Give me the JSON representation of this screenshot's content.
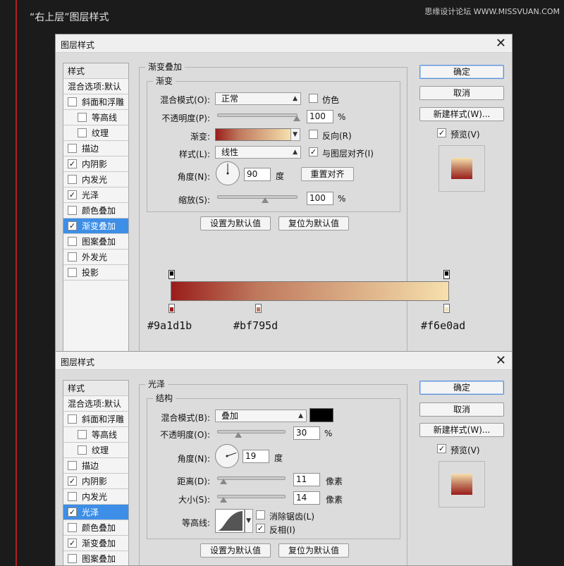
{
  "page_heading": "“右上层”图层样式",
  "watermark": "思缘设计论坛 WWW.MISSVUAN.COM",
  "dialog1": {
    "title": "图层样式",
    "styles_header": "样式",
    "blend_options": "混合选项:默认",
    "style_items": [
      {
        "label": "斜面和浮雕",
        "checked": false,
        "indent": false,
        "selected": false
      },
      {
        "label": "等高线",
        "checked": false,
        "indent": true,
        "selected": false
      },
      {
        "label": "纹理",
        "checked": false,
        "indent": true,
        "selected": false
      },
      {
        "label": "描边",
        "checked": false,
        "indent": false,
        "selected": false
      },
      {
        "label": "内阴影",
        "checked": true,
        "indent": false,
        "selected": false
      },
      {
        "label": "内发光",
        "checked": false,
        "indent": false,
        "selected": false
      },
      {
        "label": "光泽",
        "checked": true,
        "indent": false,
        "selected": false
      },
      {
        "label": "颜色叠加",
        "checked": false,
        "indent": false,
        "selected": false
      },
      {
        "label": "渐变叠加",
        "checked": true,
        "indent": false,
        "selected": true
      },
      {
        "label": "图案叠加",
        "checked": false,
        "indent": false,
        "selected": false
      },
      {
        "label": "外发光",
        "checked": false,
        "indent": false,
        "selected": false
      },
      {
        "label": "投影",
        "checked": false,
        "indent": false,
        "selected": false
      }
    ],
    "section_title": "渐变叠加",
    "subsection_title": "渐变",
    "blend_mode_label": "混合模式(O):",
    "blend_mode_value": "正常",
    "dither_label": "仿色",
    "dither_checked": false,
    "opacity_label": "不透明度(P):",
    "opacity_value": "100",
    "percent": "%",
    "opacity_level": 1.0,
    "gradient_label": "渐变:",
    "reverse_label": "反向(R)",
    "reverse_checked": false,
    "style_label": "样式(L):",
    "style_value": "线性",
    "align_label": "与图层对齐(I)",
    "align_checked": true,
    "angle_label": "角度(N):",
    "angle_value": "90",
    "angle_degrees": 90,
    "degree_unit": "度",
    "reset_align_button": "重置对齐",
    "scale_label": "缩放(S):",
    "scale_value": "100",
    "scale_level": 0.6,
    "set_default_button": "设置为默认值",
    "reset_default_button": "复位为默认值",
    "ok_button": "确定",
    "cancel_button": "取消",
    "new_style_button": "新建样式(W)...",
    "preview_label": "预览(V)",
    "preview_checked": true,
    "gradient_stops": [
      {
        "hex": "#9a1d1b",
        "color": "#9a1d1b",
        "location": 0.0
      },
      {
        "hex": "#bf795d",
        "color": "#bf795d",
        "location": 0.31
      },
      {
        "hex": "#f6e0ad",
        "color": "#f6e0ad",
        "location": 1.0
      }
    ]
  },
  "dialog2": {
    "title": "图层样式",
    "styles_header": "样式",
    "blend_options": "混合选项:默认",
    "style_items": [
      {
        "label": "斜面和浮雕",
        "checked": false,
        "indent": false,
        "selected": false
      },
      {
        "label": "等高线",
        "checked": false,
        "indent": true,
        "selected": false
      },
      {
        "label": "纹理",
        "checked": false,
        "indent": true,
        "selected": false
      },
      {
        "label": "描边",
        "checked": false,
        "indent": false,
        "selected": false
      },
      {
        "label": "内阴影",
        "checked": true,
        "indent": false,
        "selected": false
      },
      {
        "label": "内发光",
        "checked": false,
        "indent": false,
        "selected": false
      },
      {
        "label": "光泽",
        "checked": true,
        "indent": false,
        "selected": true
      },
      {
        "label": "颜色叠加",
        "checked": false,
        "indent": false,
        "selected": false
      },
      {
        "label": "渐变叠加",
        "checked": true,
        "indent": false,
        "selected": false
      },
      {
        "label": "图案叠加",
        "checked": false,
        "indent": false,
        "selected": false
      }
    ],
    "section_title": "光泽",
    "subsection_title": "结构",
    "blend_mode_label": "混合模式(B):",
    "blend_mode_value": "叠加",
    "blend_color": "#000000",
    "opacity_label": "不透明度(O):",
    "opacity_value": "30",
    "percent": "%",
    "opacity_level": 0.3,
    "angle_label": "角度(N):",
    "angle_value": "19",
    "angle_degrees": 19,
    "degree_unit": "度",
    "distance_label": "距离(D):",
    "distance_value": "11",
    "distance_level": 0.08,
    "size_label": "大小(S):",
    "size_value": "14",
    "size_level": 0.08,
    "pixel_unit": "像素",
    "contour_label": "等高线:",
    "antialias_label": "消除锯齿(L)",
    "antialias_checked": false,
    "invert_label": "反相(I)",
    "invert_checked": true,
    "set_default_button": "设置为默认值",
    "reset_default_button": "复位为默认值",
    "ok_button": "确定",
    "cancel_button": "取消",
    "new_style_button": "新建样式(W)...",
    "preview_label": "预览(V)",
    "preview_checked": true
  }
}
